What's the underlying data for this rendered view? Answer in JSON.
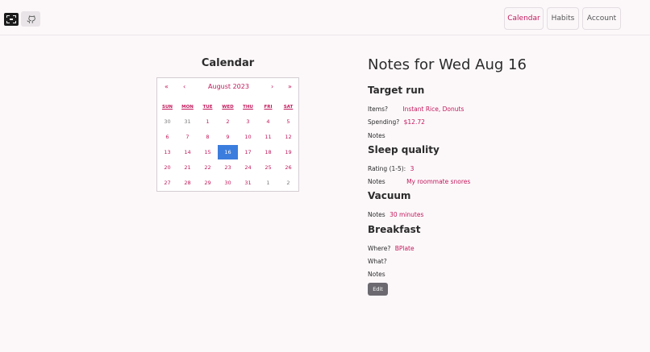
{
  "nav": {
    "calendar": "Calendar",
    "habits": "Habits",
    "account": "Account"
  },
  "calendar": {
    "title": "Calendar",
    "month_label": "August 2023",
    "prev_year": "«",
    "prev_month": "‹",
    "next_month": "›",
    "next_year": "»",
    "weekdays": [
      "SUN",
      "MON",
      "TUE",
      "WED",
      "THU",
      "FRI",
      "SAT"
    ],
    "weeks": [
      [
        "30",
        "31",
        "1",
        "2",
        "3",
        "4",
        "5"
      ],
      [
        "6",
        "7",
        "8",
        "9",
        "10",
        "11",
        "12"
      ],
      [
        "13",
        "14",
        "15",
        "16",
        "17",
        "18",
        "19"
      ],
      [
        "20",
        "21",
        "22",
        "23",
        "24",
        "25",
        "26"
      ],
      [
        "27",
        "28",
        "29",
        "30",
        "31",
        "1",
        "2"
      ]
    ],
    "selected_day": "16"
  },
  "notes": {
    "title": "Notes for Wed Aug 16",
    "target_run": {
      "heading": "Target run",
      "items_label": "Items?",
      "items_value": "Instant Rice, Donuts",
      "spending_label": "Spending?",
      "spending_value": "$12.72",
      "notes_label": "Notes"
    },
    "sleep_quality": {
      "heading": "Sleep quality",
      "rating_label": "Rating (1-5):",
      "rating_value": "3",
      "notes_label": "Notes",
      "notes_value": "My roommate snores"
    },
    "vacuum": {
      "heading": "Vacuum",
      "notes_label": "Notes",
      "notes_value": "30 minutes"
    },
    "breakfast": {
      "heading": "Breakfast",
      "where_label": "Where?",
      "where_value": "BPlate",
      "what_label": "What?",
      "notes_label": "Notes"
    },
    "edit_label": "Edit"
  },
  "colors": {
    "accent": "#c2185b",
    "selected": "#3b7ddd",
    "background": "#fcf8fa"
  }
}
